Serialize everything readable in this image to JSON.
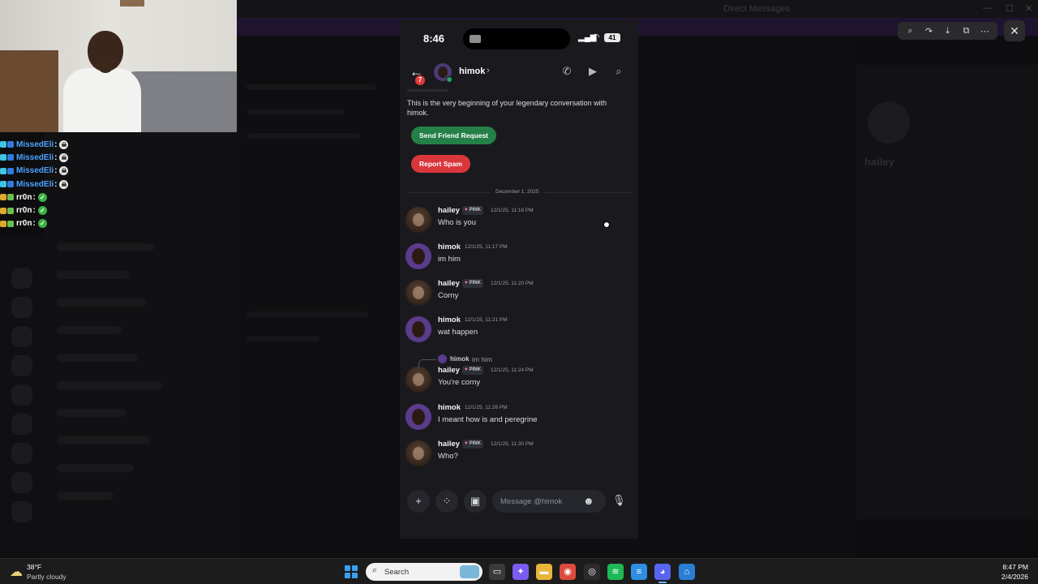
{
  "background_window": {
    "title": "Direct Messages",
    "profile_name": "hailey"
  },
  "webcam": {
    "description_hidden": true
  },
  "stream_chat": [
    {
      "name": "MissedEli",
      "color": "#4da3ff",
      "emote": "skull-emote"
    },
    {
      "name": "MissedEli",
      "color": "#4da3ff",
      "emote": "skull-emote"
    },
    {
      "name": "MissedEli",
      "color": "#4da3ff",
      "emote": "skull-emote"
    },
    {
      "name": "MissedEli",
      "color": "#4da3ff",
      "emote": "skull-emote"
    },
    {
      "name": "rr0n",
      "color": "#ffffff",
      "emote": "check-emote"
    },
    {
      "name": "rr0n",
      "color": "#ffffff",
      "emote": "check-emote"
    },
    {
      "name": "rr0n",
      "color": "#ffffff",
      "emote": "check-emote"
    }
  ],
  "viewer_toolbar": {
    "icons": [
      "zoom-icon",
      "share-icon",
      "download-icon",
      "open-external-icon",
      "more-icon"
    ],
    "close_glyph": "✕"
  },
  "phone": {
    "status": {
      "time": "8:46",
      "battery": "41"
    },
    "header": {
      "name": "himok",
      "unread": "7"
    },
    "intro": "This is the very beginning of your legendary conversation with himok.",
    "buttons": {
      "friend": "Send Friend Request",
      "spam": "Report Spam"
    },
    "divider": "December 1, 2025",
    "reply": {
      "name": "himok",
      "text": "im him"
    },
    "messages": [
      {
        "author": "hailey",
        "tag": "PINK",
        "time": "12/1/25, 11:16 PM",
        "text": "Who is you"
      },
      {
        "author": "himok",
        "tag": "",
        "time": "12/1/25, 11:17 PM",
        "text": "im him"
      },
      {
        "author": "hailey",
        "tag": "PINK",
        "time": "12/1/25, 11:20 PM",
        "text": "Corny"
      },
      {
        "author": "himok",
        "tag": "",
        "time": "12/1/25, 11:21 PM",
        "text": "wat happen"
      },
      {
        "author": "hailey",
        "tag": "PINK",
        "time": "12/1/25, 11:24 PM",
        "text": "You're corny"
      },
      {
        "author": "himok",
        "tag": "",
        "time": "12/1/25, 11:26 PM",
        "text": "I meant how is and peregrine"
      },
      {
        "author": "hailey",
        "tag": "PINK",
        "time": "12/1/25, 11:30 PM",
        "text": "Who?"
      }
    ],
    "input_placeholder": "Message @himok"
  },
  "taskbar": {
    "temp": "38°F",
    "condition": "Partly cloudy",
    "search": "Search",
    "time": "8:47 PM",
    "date": "2/4/2026",
    "apps": [
      "file-explorer-icon",
      "copilot-icon",
      "folder-icon",
      "chrome-icon",
      "obs-icon",
      "spotify-icon",
      "notepad-icon",
      "discord-icon",
      "app-store-icon"
    ]
  }
}
